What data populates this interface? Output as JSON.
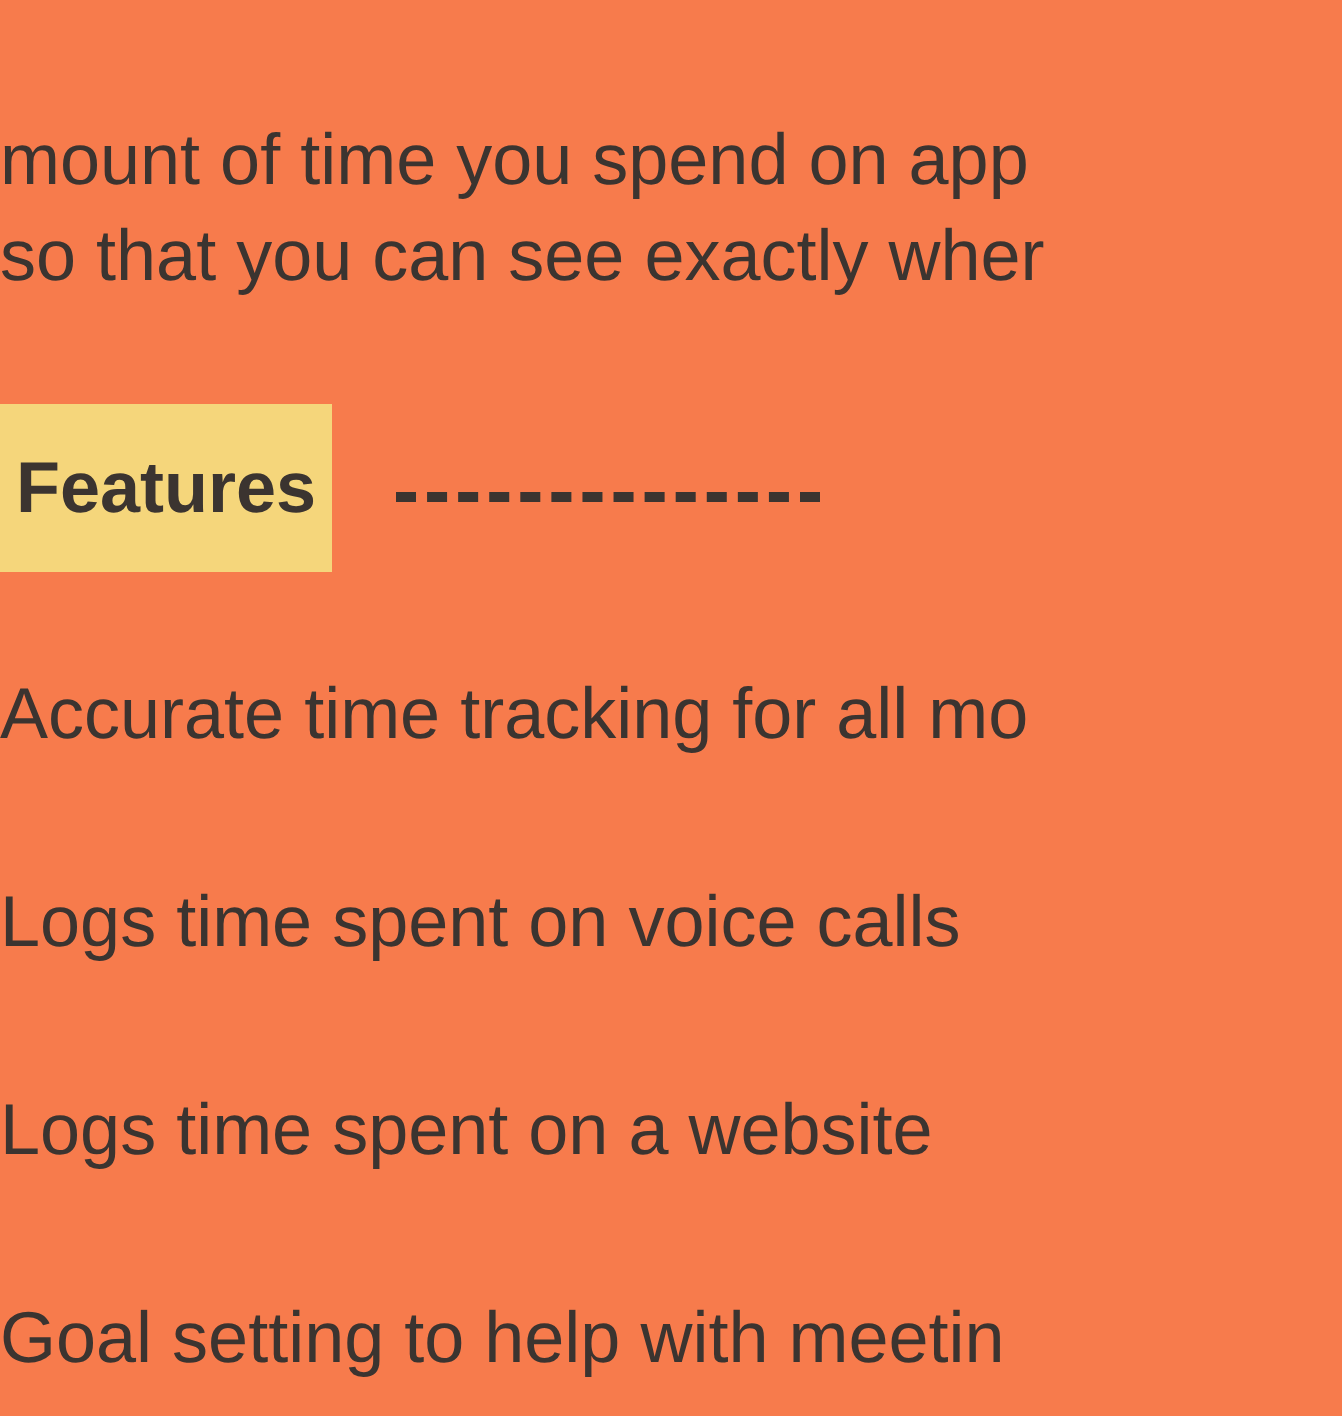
{
  "intro": [
    "mount of time you spend on app",
    "so that you can see exactly wher"
  ],
  "section": {
    "heading": "Features"
  },
  "features": [
    "Accurate time tracking for all mo",
    "Logs time spent on voice calls",
    "Logs time spent on a website",
    "Goal setting to help with meetin"
  ]
}
